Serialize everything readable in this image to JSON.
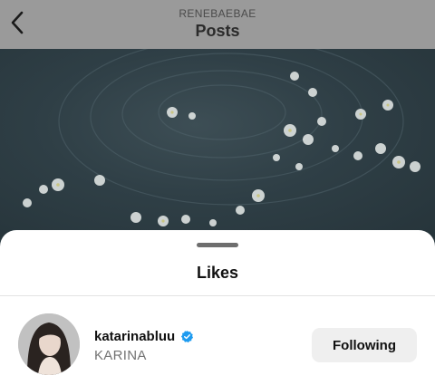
{
  "header": {
    "account_name": "RENEBAEBAE",
    "title": "Posts"
  },
  "icons": {
    "back": "chevron-left-icon",
    "verified": "verified-badge-icon"
  },
  "likes_sheet": {
    "title": "Likes",
    "users": [
      {
        "username": "katarinabluu",
        "full_name": "KARINA",
        "verified": true,
        "follow_button_label": "Following"
      }
    ]
  },
  "colors": {
    "verified_blue": "#1D9BF0",
    "following_button_bg": "#EFEFEF"
  }
}
